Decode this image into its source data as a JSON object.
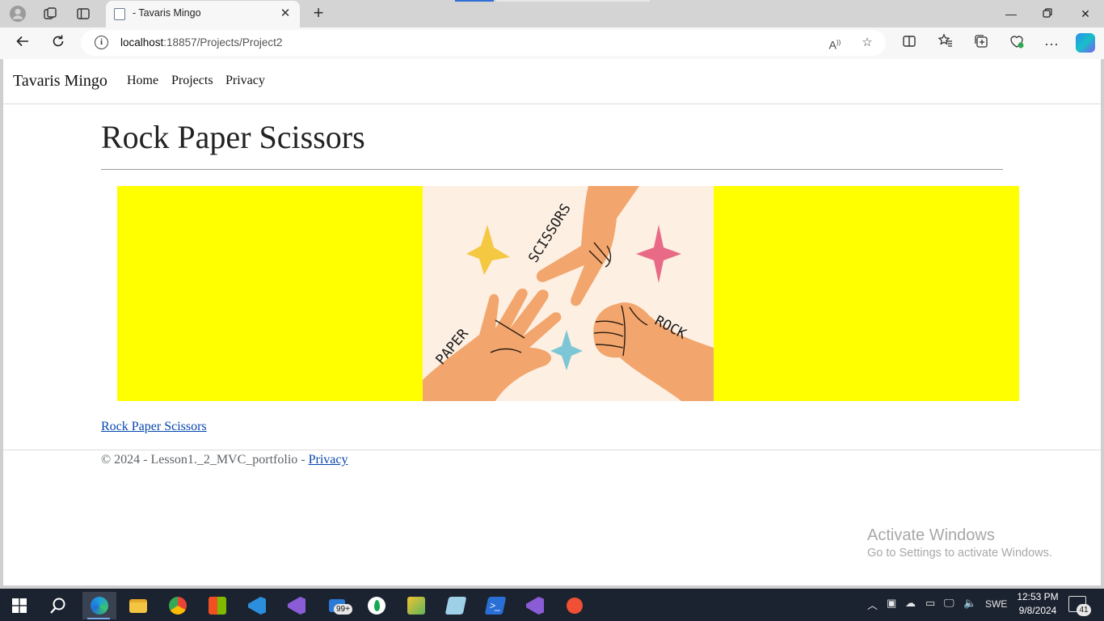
{
  "browser": {
    "tab_title": "- Tavaris Mingo",
    "url_host": "localhost",
    "url_path": ":18857/Projects/Project2"
  },
  "site": {
    "brand": "Tavaris Mingo",
    "nav": [
      "Home",
      "Projects",
      "Privacy"
    ]
  },
  "main": {
    "title": "Rock Paper Scissors",
    "art_words": {
      "scissors": "SCISSORS",
      "paper": "PAPER",
      "rock": "ROCK"
    },
    "link_text": "Rock Paper Scissors"
  },
  "footer": {
    "text": "© 2024 - Lesson1._2_MVC_portfolio - ",
    "privacy": "Privacy"
  },
  "watermark": {
    "line1": "Activate Windows",
    "line2": "Go to Settings to activate Windows."
  },
  "taskbar": {
    "mail_badge": "99+",
    "language": "SWE",
    "time": "12:53 PM",
    "date": "9/8/2024",
    "notification_count": "41"
  },
  "colors": {
    "hero_background": "#ffff00",
    "art_background": "#fdefe2",
    "link": "#0645ad"
  }
}
